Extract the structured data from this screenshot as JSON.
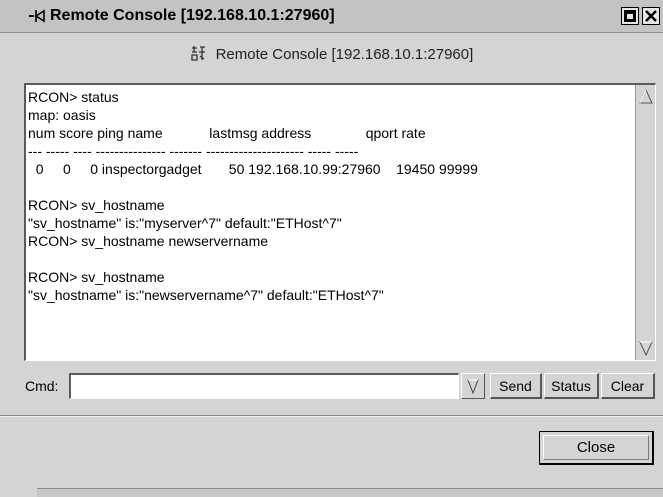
{
  "window": {
    "title": "Remote Console [192.168.10.1:27960]",
    "title_icon": "pin-icon"
  },
  "header": {
    "label": "Remote Console [192.168.10.1:27960]",
    "icon": "console-icon"
  },
  "console": {
    "lines": [
      "RCON> status",
      "map: oasis",
      "num score ping name            lastmsg address              qport rate",
      "--- ----- ---- --------------- ------- --------------------- ----- -----",
      "  0     0     0 inspectorgadget       50 192.168.10.99:27960    19450 99999",
      "",
      "RCON> sv_hostname",
      "\"sv_hostname\" is:\"myserver^7\" default:\"ETHost^7\"",
      "RCON> sv_hostname newservername",
      "",
      "RCON> sv_hostname",
      "\"sv_hostname\" is:\"newservername^7\" default:\"ETHost^7\""
    ]
  },
  "command": {
    "label": "Cmd:",
    "value": "",
    "placeholder": ""
  },
  "buttons": {
    "send": "Send",
    "status": "Status",
    "clear": "Clear",
    "close": "Close"
  },
  "colors": {
    "window_bg": "#d4d4d4",
    "console_bg": "#ffffff"
  }
}
